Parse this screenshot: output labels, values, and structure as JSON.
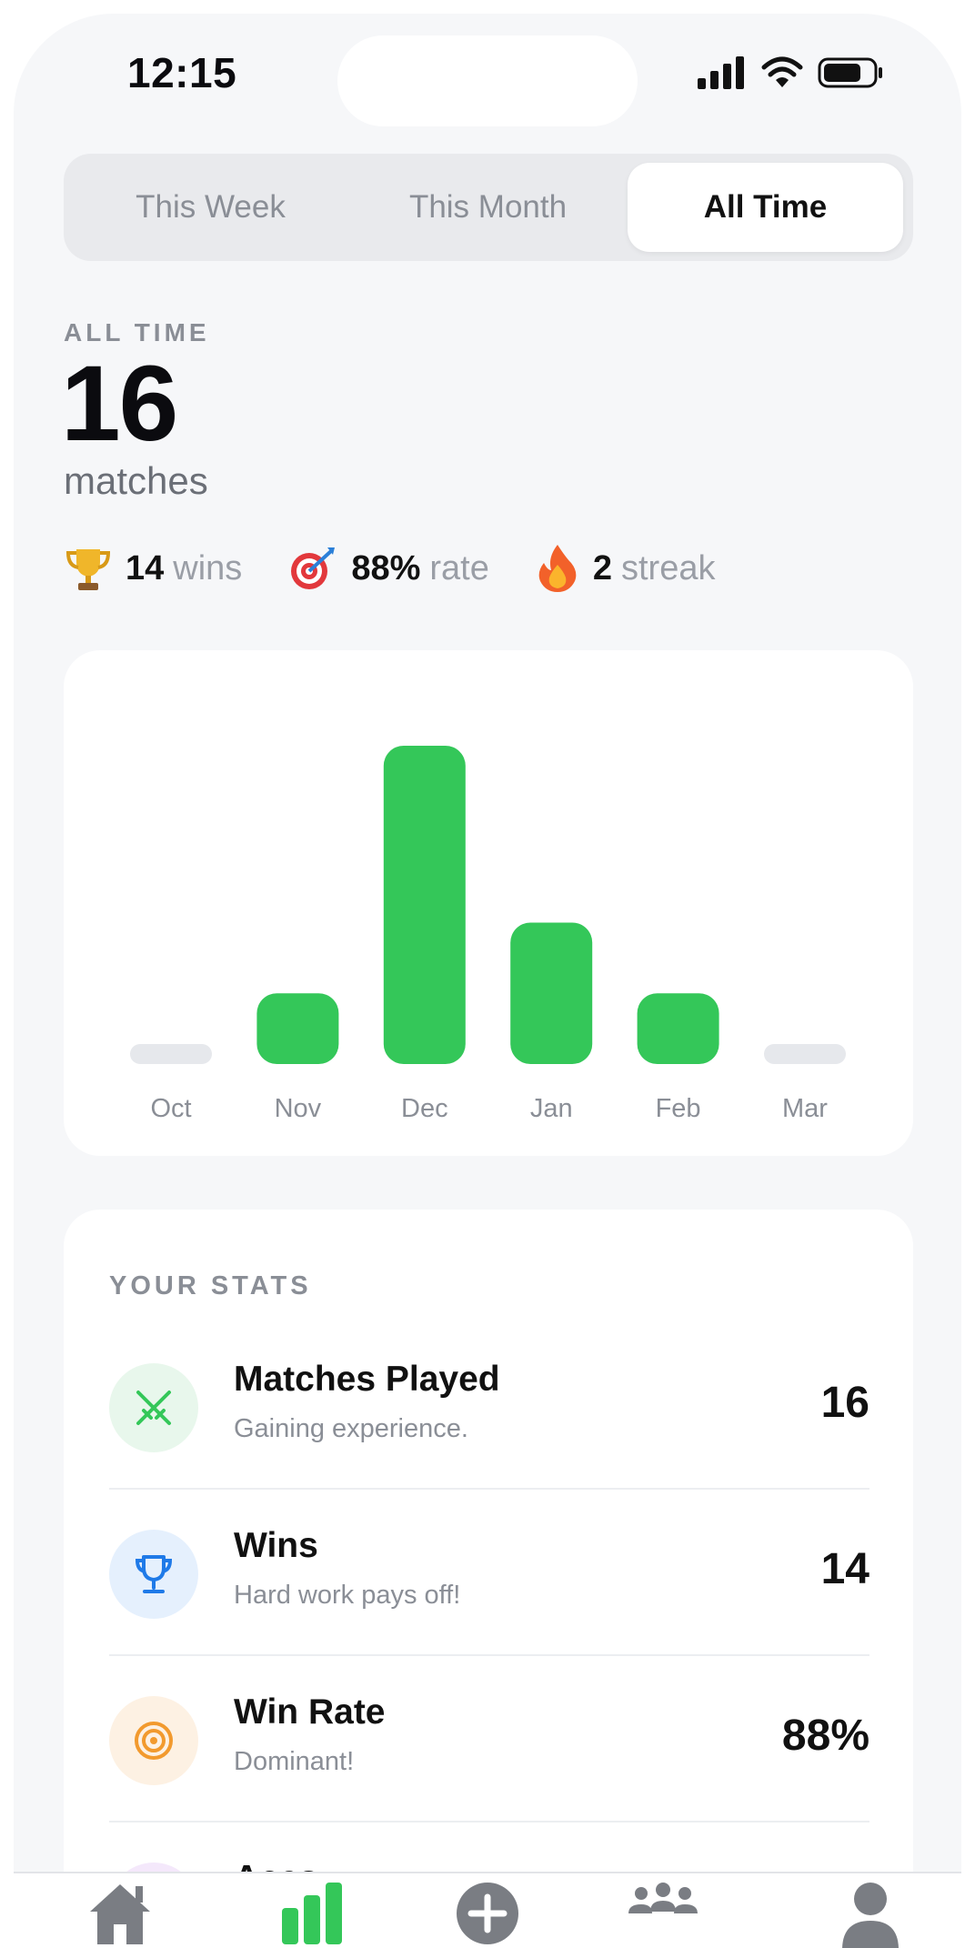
{
  "status_bar": {
    "time": "12:15"
  },
  "segments": [
    {
      "label": "This Week",
      "active": false
    },
    {
      "label": "This Month",
      "active": false
    },
    {
      "label": "All Time",
      "active": true
    }
  ],
  "summary": {
    "period_label": "ALL TIME",
    "count": "16",
    "unit": "matches",
    "quick_stats": [
      {
        "icon": "trophy-icon",
        "value": "14",
        "label": "wins"
      },
      {
        "icon": "target-icon",
        "value": "88%",
        "label": "rate"
      },
      {
        "icon": "fire-icon",
        "value": "2",
        "label": "streak"
      }
    ]
  },
  "chart_data": {
    "type": "bar",
    "categories": [
      "Oct",
      "Nov",
      "Dec",
      "Jan",
      "Feb",
      "Mar"
    ],
    "values": [
      0,
      2,
      9,
      4,
      2,
      0
    ],
    "title": "",
    "xlabel": "",
    "ylabel": "",
    "ylim": [
      0,
      9
    ],
    "grid": false,
    "colors": {
      "bar": "#34c759",
      "empty": "#e6e8ec"
    }
  },
  "stats": {
    "heading": "YOUR STATS",
    "rows": [
      {
        "title": "Matches Played",
        "subtitle": "Gaining experience.",
        "value": "16",
        "icon": "crossed-swords-icon",
        "icon_color": "#34c759",
        "icon_bg": "#e8f7ec"
      },
      {
        "title": "Wins",
        "subtitle": "Hard work pays off!",
        "value": "14",
        "icon": "trophy-icon",
        "icon_color": "#1f7ae8",
        "icon_bg": "#e5f0fd"
      },
      {
        "title": "Win Rate",
        "subtitle": "Dominant!",
        "value": "88%",
        "icon": "target-icon",
        "icon_color": "#f29a2e",
        "icon_bg": "#fdf1e3"
      },
      {
        "title": "Aces",
        "subtitle": "",
        "value": "",
        "icon": "ace-icon",
        "icon_color": "#a35ad6",
        "icon_bg": "#f4e8fb"
      }
    ]
  },
  "tabbar": {
    "items": [
      {
        "icon": "home-icon",
        "active": false
      },
      {
        "icon": "stats-icon",
        "active": true
      },
      {
        "icon": "add-icon",
        "active": false
      },
      {
        "icon": "group-icon",
        "active": false
      },
      {
        "icon": "profile-icon",
        "active": false
      }
    ],
    "colors": {
      "active": "#34c759",
      "inactive": "#7a7d83"
    }
  }
}
